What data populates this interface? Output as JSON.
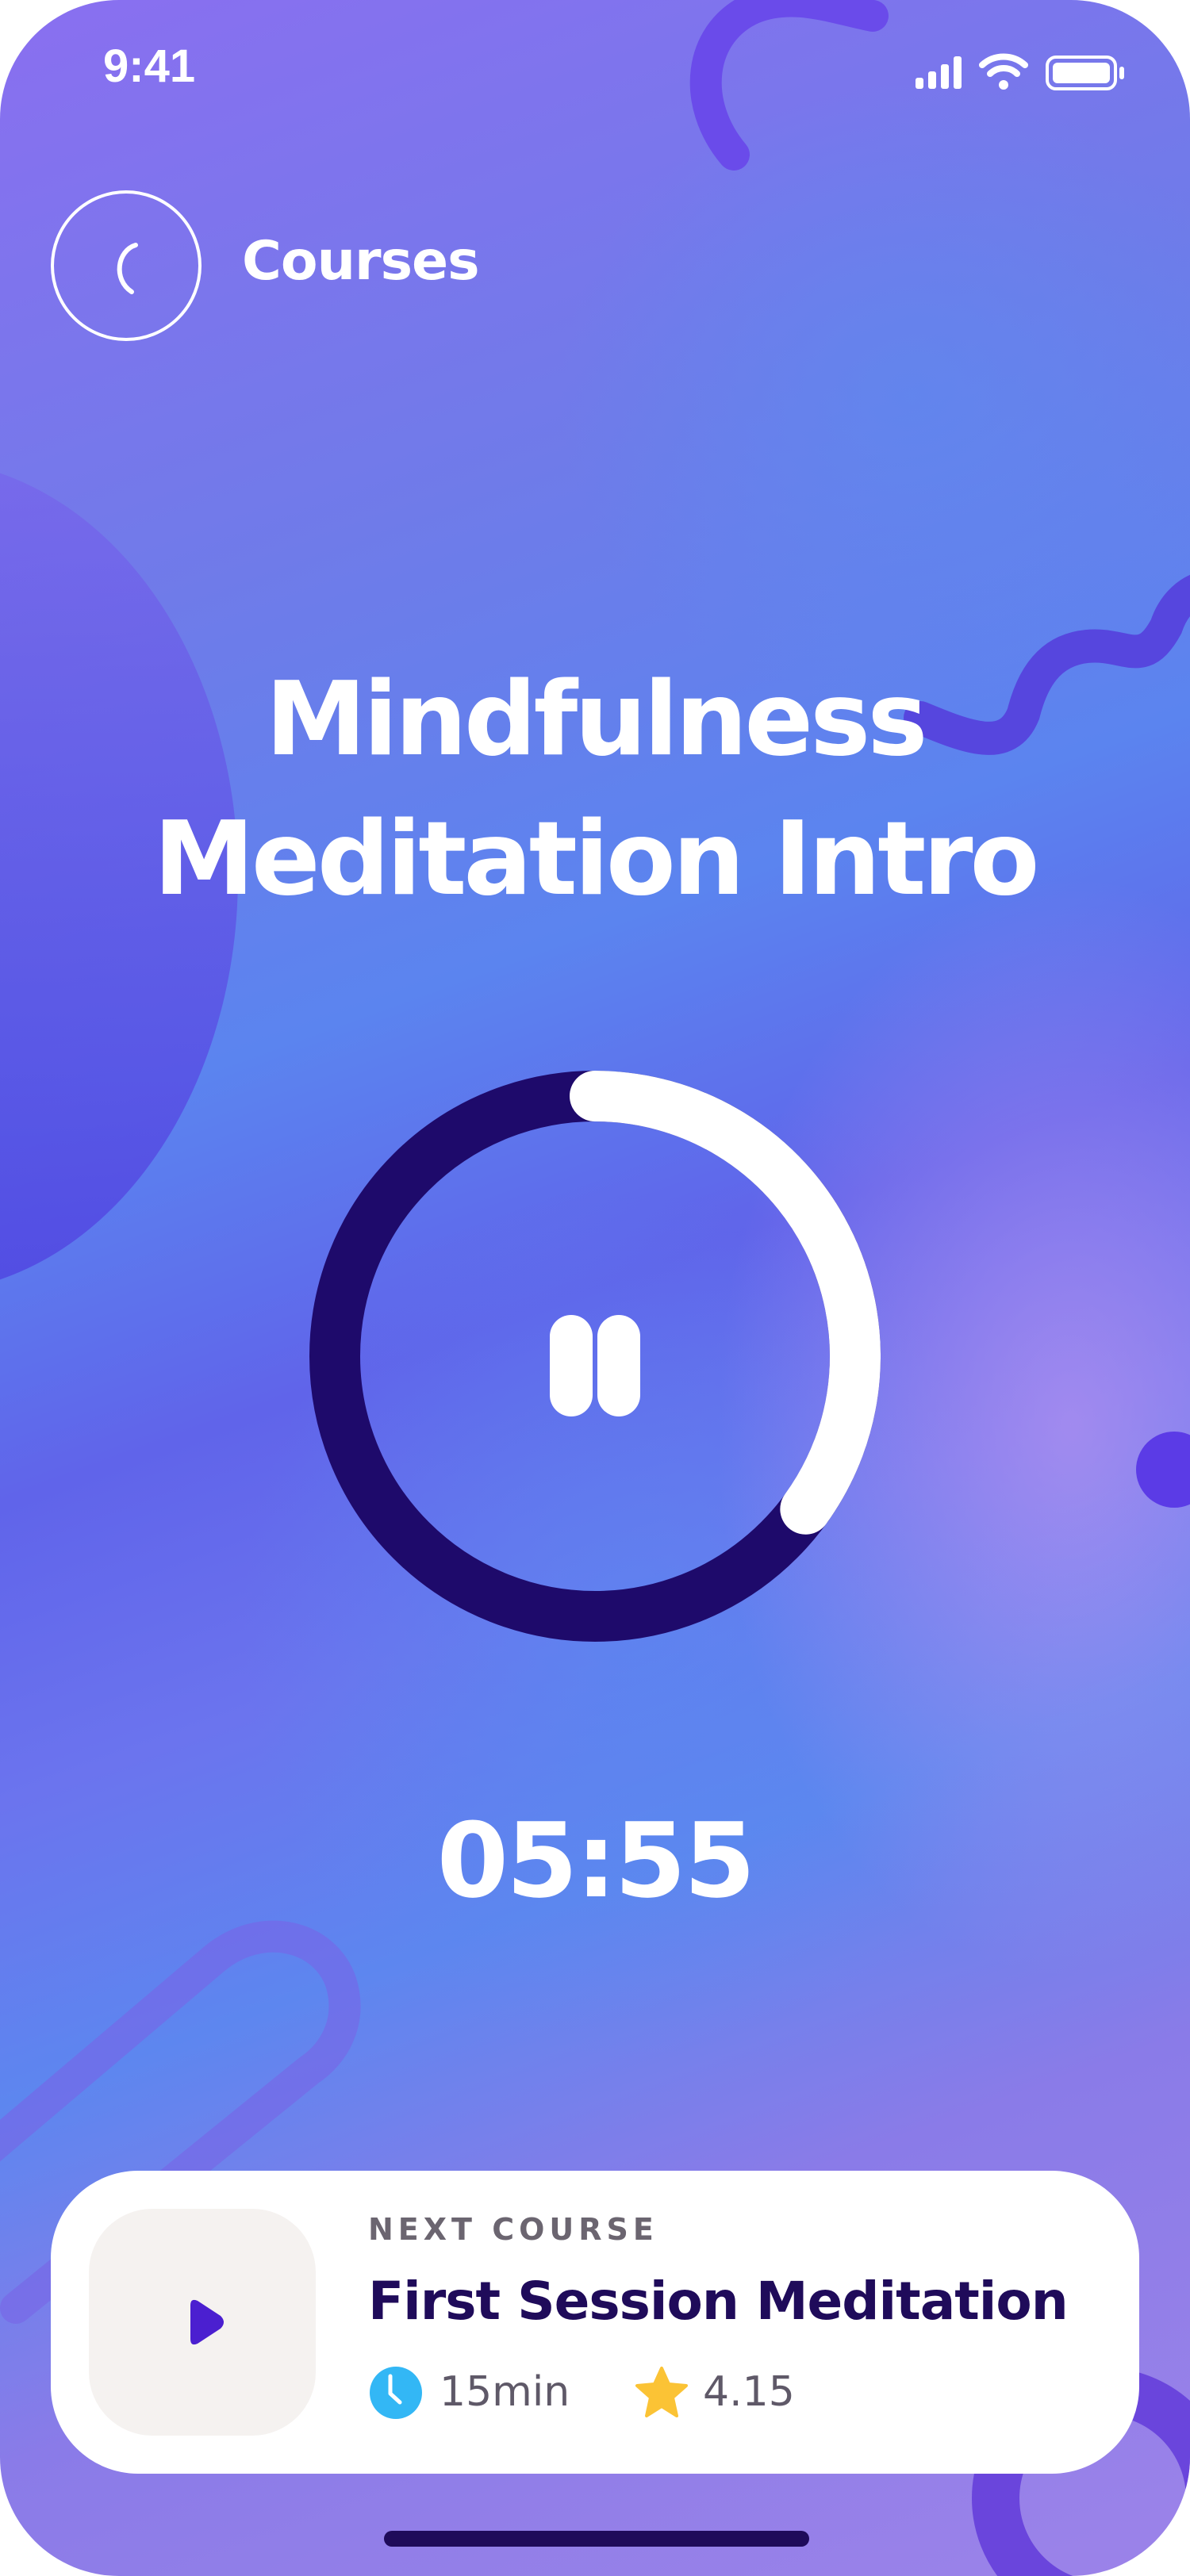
{
  "status_bar": {
    "time": "9:41"
  },
  "nav": {
    "back_icon": "chevron-left-icon",
    "title": "Courses"
  },
  "course": {
    "title": "Mindfulness Meditation Intro"
  },
  "player": {
    "state_icon": "pause-icon",
    "progress": 0.35,
    "timer": "05:55",
    "colors": {
      "track": "#1e0a6b",
      "progress": "#ffffff"
    }
  },
  "next_course": {
    "label": "NEXT COURSE",
    "title": "First Session Meditation",
    "duration": "15min",
    "rating": "4.15",
    "duration_icon": "clock-icon",
    "rating_icon": "star-icon",
    "thumb_icon": "play-icon",
    "colors": {
      "clock": "#33b7f5",
      "star": "#fbc335",
      "play": "#4b1fd0"
    }
  }
}
